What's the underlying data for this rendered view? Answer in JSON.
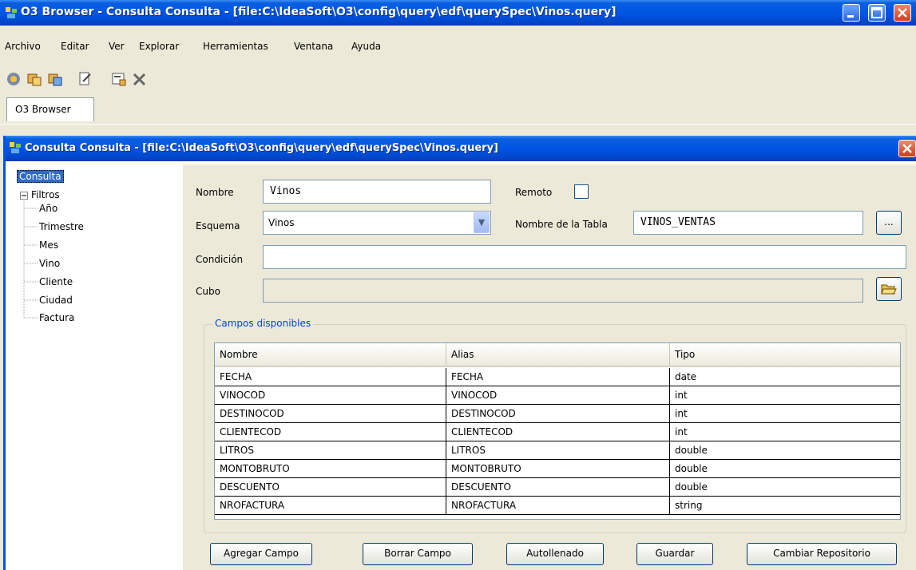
{
  "window": {
    "title": "O3 Browser - Consulta Consulta - [file:C:\\IdeaSoft\\O3\\config\\query\\edf\\querySpec\\Vinos.query]"
  },
  "menu": [
    "Archivo",
    "Editar",
    "Ver",
    "Explorar",
    "Herramientas",
    "Ventana",
    "Ayuda"
  ],
  "tab": {
    "label": "O3 Browser"
  },
  "inner": {
    "title": "Consulta Consulta - [file:C:\\IdeaSoft\\O3\\config\\query\\edf\\querySpec\\Vinos.query]"
  },
  "tree": {
    "root": "Consulta",
    "filtros": "Filtros",
    "children": [
      "Año",
      "Trimestre",
      "Mes",
      "Vino",
      "Cliente",
      "Ciudad",
      "Factura"
    ]
  },
  "form": {
    "nombre_label": "Nombre",
    "nombre_value": "Vinos",
    "remoto_label": "Remoto",
    "esquema_label": "Esquema",
    "esquema_value": "Vinos",
    "tabla_label": "Nombre de la Tabla",
    "tabla_value": "VINOS_VENTAS",
    "browse_label": "...",
    "condicion_label": "Condición",
    "condicion_value": "",
    "cubo_label": "Cubo",
    "cubo_value": ""
  },
  "campos": {
    "title": "Campos disponibles",
    "columns": [
      "Nombre",
      "Alias",
      "Tipo"
    ],
    "rows": [
      [
        "FECHA",
        "FECHA",
        "date"
      ],
      [
        "VINOCOD",
        "VINOCOD",
        "int"
      ],
      [
        "DESTINOCOD",
        "DESTINOCOD",
        "int"
      ],
      [
        "CLIENTECOD",
        "CLIENTECOD",
        "int"
      ],
      [
        "LITROS",
        "LITROS",
        "double"
      ],
      [
        "MONTOBRUTO",
        "MONTOBRUTO",
        "double"
      ],
      [
        "DESCUENTO",
        "DESCUENTO",
        "double"
      ],
      [
        "NROFACTURA",
        "NROFACTURA",
        "string"
      ]
    ]
  },
  "buttons": {
    "agregar": "Agregar Campo",
    "borrar": "Borrar Campo",
    "autollenado": "Autollenado",
    "guardar": "Guardar",
    "cambiar": "Cambiar Repositorio"
  }
}
